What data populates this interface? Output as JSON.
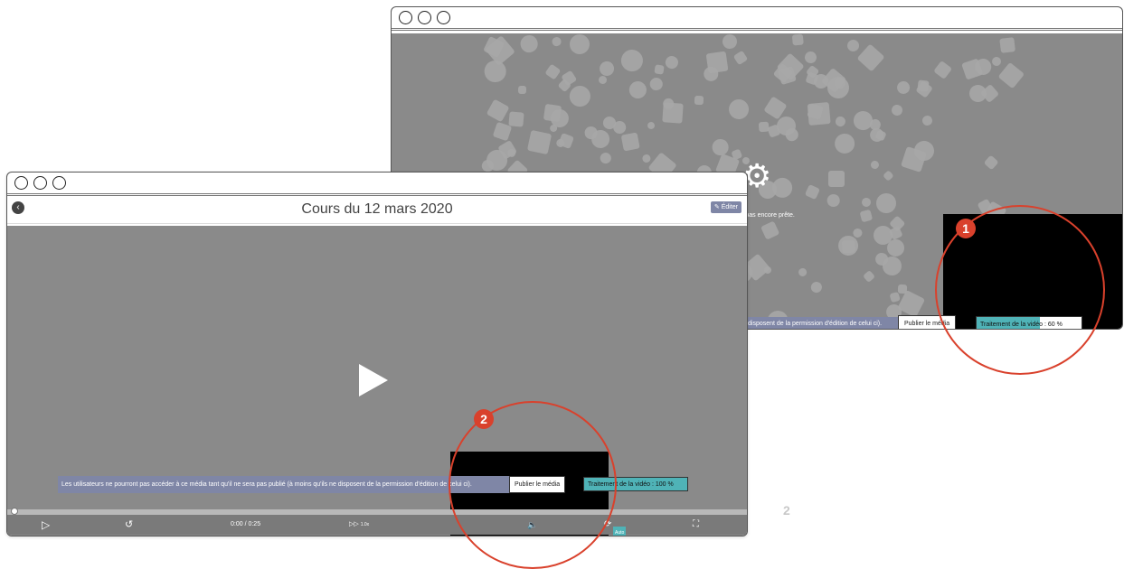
{
  "back_window": {
    "message": "st pas encore prête.",
    "banner": "disposent de la permission d'édition de celui ci).",
    "publish_button": "Publier le média",
    "processing": {
      "label": "Traitement de la vidéo : 60 %",
      "progress": 0.6
    }
  },
  "front_window": {
    "title": "Cours du 12 mars 2020",
    "edit_button": "Éditer",
    "banner": "Les utilisateurs ne pourront pas accéder à ce média tant qu'il ne sera pas publié (à moins qu'ils ne disposent de la permission d'édition de celui ci).",
    "publish_button": "Publier le média",
    "processing": {
      "label": "Traitement de la vidéo : 100 %",
      "progress": 1.0
    },
    "player": {
      "time": "0:00 / 0:25",
      "speed": "1.0x",
      "quality": "Auto",
      "seek_position": 0.0
    }
  },
  "callouts": {
    "one": "1",
    "two": "2"
  },
  "stray_label": "2",
  "colors": {
    "accent": "#d9412c",
    "progress": "#4fb3b7",
    "banner": "#7f86a6",
    "video_bg": "#8a8a8a"
  },
  "icons": [
    "back-arrow-icon",
    "pencil-icon",
    "gears-icon",
    "play-icon",
    "replay-icon",
    "speed-icon",
    "volume-icon",
    "settings-icon",
    "fullscreen-icon"
  ]
}
